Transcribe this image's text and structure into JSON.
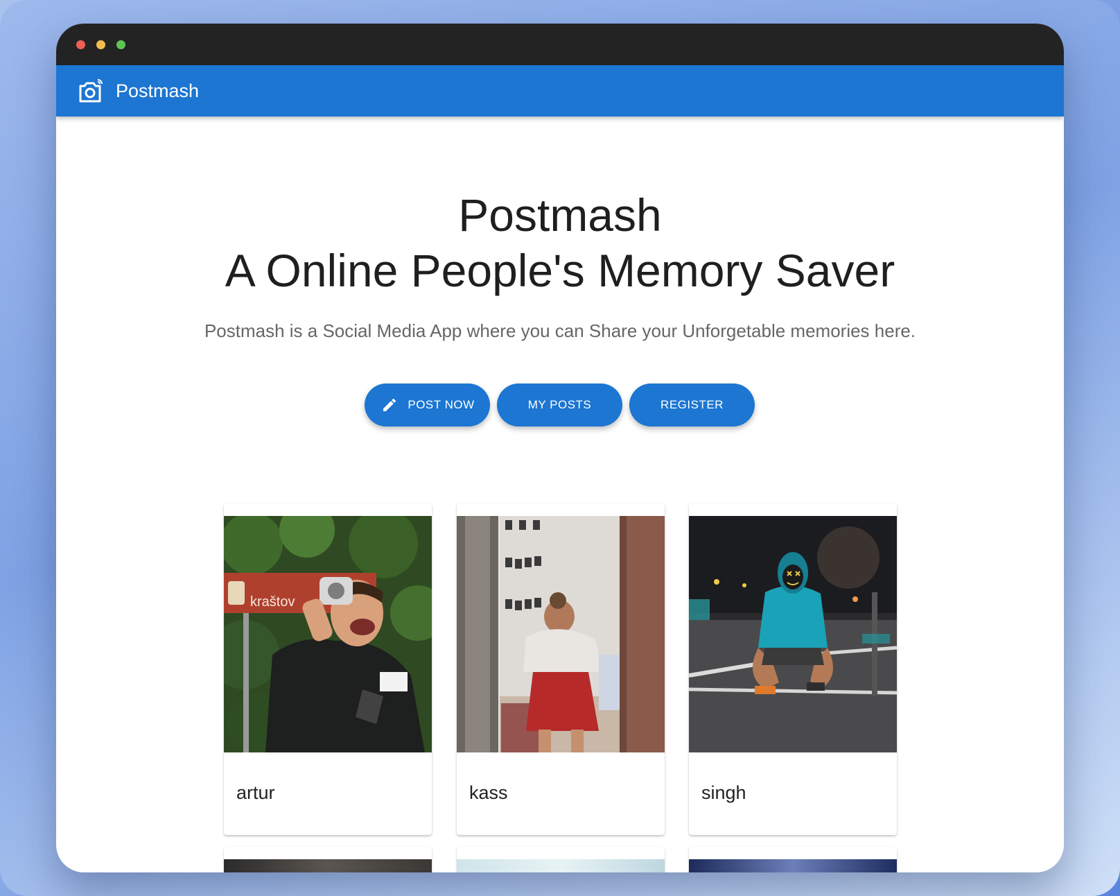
{
  "window": {
    "title_buttons": [
      "close",
      "minimize",
      "maximize"
    ],
    "colors": {
      "close": "#ee5f57",
      "minimize": "#f5bd4f",
      "maximize": "#5fc454"
    }
  },
  "appbar": {
    "brand_name": "Postmash",
    "brand_icon": "camera-icon",
    "color": "#1c76d2"
  },
  "hero": {
    "title_line1": "Postmash",
    "title_line2": "A Online People's Memory Saver",
    "subtitle": "Postmash is a Social Media App where you can Share your Unforgetable memories here."
  },
  "actions": {
    "post_now": {
      "label": "POST NOW",
      "icon": "pencil-icon"
    },
    "my_posts": {
      "label": "MY POSTS"
    },
    "register": {
      "label": "REGISTER"
    }
  },
  "posts": [
    {
      "name": "artur",
      "image": "man-with-camera-photo"
    },
    {
      "name": "kass",
      "image": "woman-in-room-photo"
    },
    {
      "name": "singh",
      "image": "masked-person-street-photo"
    }
  ],
  "posts_row2": [
    {
      "image": "dark-photo"
    },
    {
      "image": "light-sky-photo"
    },
    {
      "image": "blue-night-photo"
    }
  ]
}
